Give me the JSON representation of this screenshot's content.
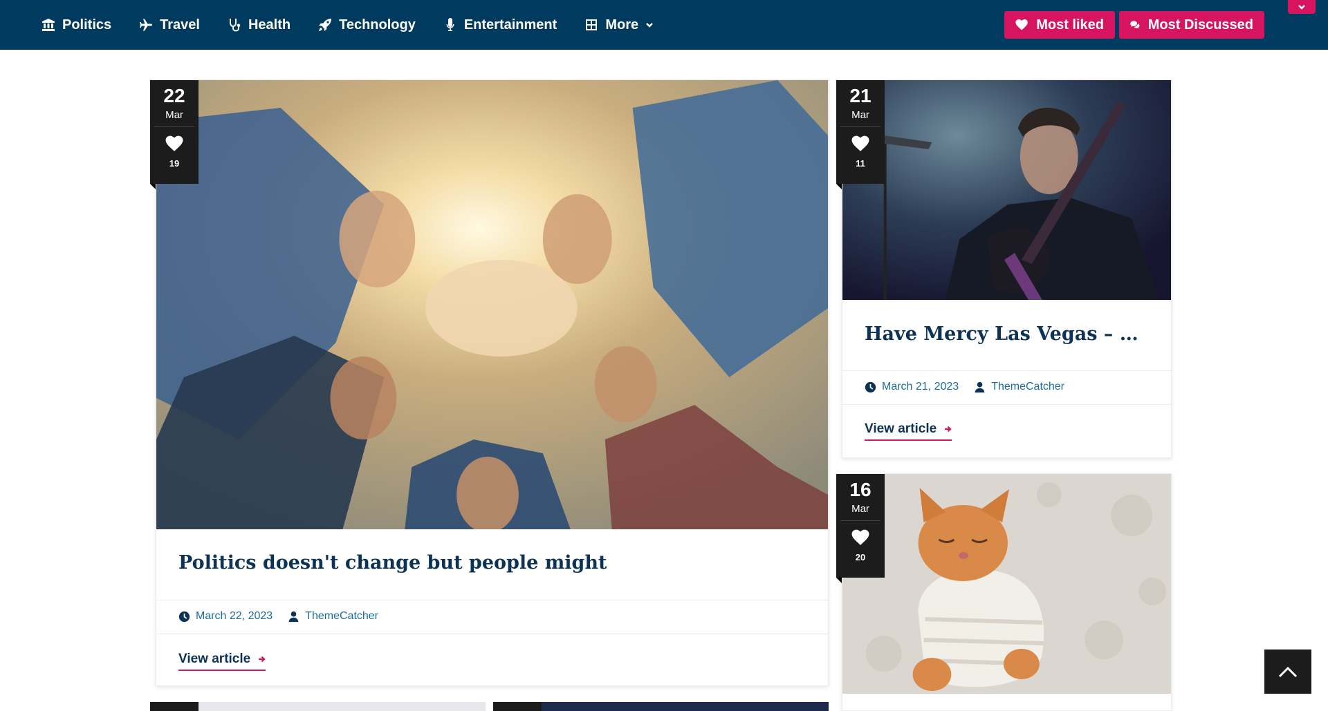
{
  "nav": {
    "items": [
      {
        "label": "Politics",
        "icon": "bank-icon"
      },
      {
        "label": "Travel",
        "icon": "airplane-icon"
      },
      {
        "label": "Health",
        "icon": "stethoscope-icon"
      },
      {
        "label": "Technology",
        "icon": "rocket-icon"
      },
      {
        "label": "Entertainment",
        "icon": "microphone-icon"
      },
      {
        "label": "More",
        "icon": "grid-icon"
      }
    ],
    "most_liked": "Most liked",
    "most_discussed": "Most Discussed"
  },
  "articles": [
    {
      "day": "22",
      "month": "Mar",
      "likes": "19",
      "title": "Politics doesn't change but people might",
      "date": "March 22, 2023",
      "author": "ThemeCatcher",
      "link_label": "View article"
    },
    {
      "day": "21",
      "month": "Mar",
      "likes": "11",
      "title": "Have Mercy Las Vegas – St P...",
      "date": "March 21, 2023",
      "author": "ThemeCatcher",
      "link_label": "View article"
    },
    {
      "day": "16",
      "month": "Mar",
      "likes": "20"
    }
  ],
  "colors": {
    "nav_background": "#013a5f",
    "accent": "#d6145f",
    "title": "#0c3355",
    "meta_link": "#1b6d9b",
    "badge": "#1c1c1c"
  }
}
